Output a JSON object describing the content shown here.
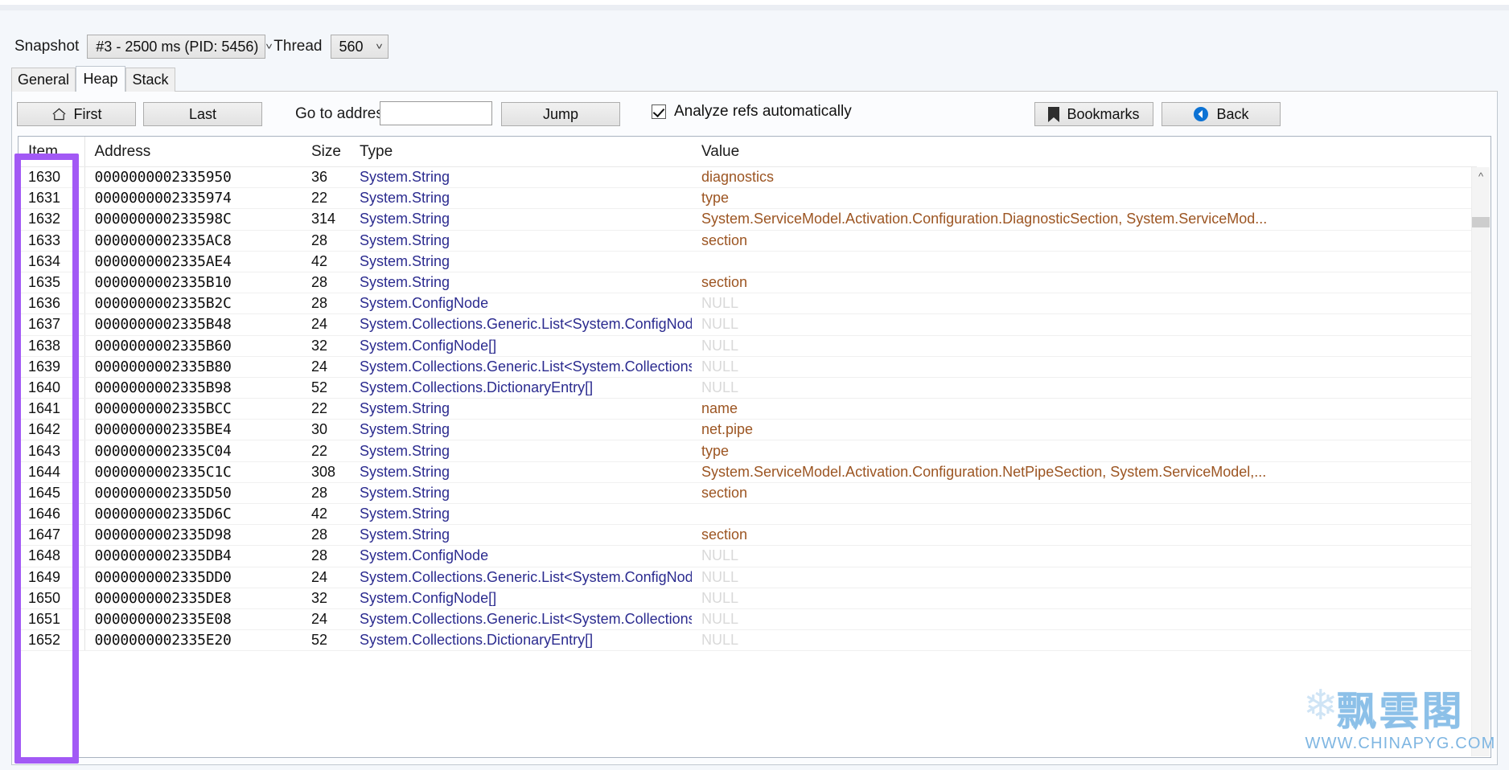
{
  "window": {
    "snapshot_label": "Snapshot",
    "snapshot_value": "#3 - 2500 ms (PID: 5456)",
    "thread_label": "Thread",
    "thread_value": "560"
  },
  "tabs": [
    {
      "label": "General",
      "selected": false
    },
    {
      "label": "Heap",
      "selected": true
    },
    {
      "label": "Stack",
      "selected": false
    }
  ],
  "toolbar": {
    "first_label": "First",
    "first_icon": "home-icon",
    "last_label": "Last",
    "goto_label": "Go to address",
    "address_value": "",
    "address_placeholder": "",
    "jump_label": "Jump",
    "analyze_label": "Analyze refs automatically",
    "analyze_checked": true,
    "bookmarks_label": "Bookmarks",
    "bookmarks_icon": "bookmark-icon",
    "back_label": "Back",
    "back_icon": "back-circle-icon"
  },
  "grid": {
    "columns": [
      "Item",
      "Address",
      "Size",
      "Type",
      "Value"
    ],
    "rows": [
      {
        "item": "1630",
        "address": "0000000002335950",
        "size": "36",
        "type": "System.String",
        "value": "diagnostics",
        "null": false
      },
      {
        "item": "1631",
        "address": "0000000002335974",
        "size": "22",
        "type": "System.String",
        "value": "type",
        "null": false
      },
      {
        "item": "1632",
        "address": "000000000233598C",
        "size": "314",
        "type": "System.String",
        "value": "System.ServiceModel.Activation.Configuration.DiagnosticSection, System.ServiceMod...",
        "null": false
      },
      {
        "item": "1633",
        "address": "0000000002335AC8",
        "size": "28",
        "type": "System.String",
        "value": "section",
        "null": false
      },
      {
        "item": "1634",
        "address": "0000000002335AE4",
        "size": "42",
        "type": "System.String",
        "value": "",
        "null": false
      },
      {
        "item": "1635",
        "address": "0000000002335B10",
        "size": "28",
        "type": "System.String",
        "value": "section",
        "null": false
      },
      {
        "item": "1636",
        "address": "0000000002335B2C",
        "size": "28",
        "type": "System.ConfigNode",
        "value": "NULL",
        "null": true
      },
      {
        "item": "1637",
        "address": "0000000002335B48",
        "size": "24",
        "type": "System.Collections.Generic.List<System.ConfigNode>",
        "value": "NULL",
        "null": true
      },
      {
        "item": "1638",
        "address": "0000000002335B60",
        "size": "32",
        "type": "System.ConfigNode[]",
        "value": "NULL",
        "null": true
      },
      {
        "item": "1639",
        "address": "0000000002335B80",
        "size": "24",
        "type": "System.Collections.Generic.List<System.Collections....",
        "value": "NULL",
        "null": true
      },
      {
        "item": "1640",
        "address": "0000000002335B98",
        "size": "52",
        "type": "System.Collections.DictionaryEntry[]",
        "value": "NULL",
        "null": true
      },
      {
        "item": "1641",
        "address": "0000000002335BCC",
        "size": "22",
        "type": "System.String",
        "value": "name",
        "null": false
      },
      {
        "item": "1642",
        "address": "0000000002335BE4",
        "size": "30",
        "type": "System.String",
        "value": "net.pipe",
        "null": false
      },
      {
        "item": "1643",
        "address": "0000000002335C04",
        "size": "22",
        "type": "System.String",
        "value": "type",
        "null": false
      },
      {
        "item": "1644",
        "address": "0000000002335C1C",
        "size": "308",
        "type": "System.String",
        "value": "System.ServiceModel.Activation.Configuration.NetPipeSection, System.ServiceModel,...",
        "null": false
      },
      {
        "item": "1645",
        "address": "0000000002335D50",
        "size": "28",
        "type": "System.String",
        "value": "section",
        "null": false
      },
      {
        "item": "1646",
        "address": "0000000002335D6C",
        "size": "42",
        "type": "System.String",
        "value": "",
        "null": false
      },
      {
        "item": "1647",
        "address": "0000000002335D98",
        "size": "28",
        "type": "System.String",
        "value": "section",
        "null": false
      },
      {
        "item": "1648",
        "address": "0000000002335DB4",
        "size": "28",
        "type": "System.ConfigNode",
        "value": "NULL",
        "null": true
      },
      {
        "item": "1649",
        "address": "0000000002335DD0",
        "size": "24",
        "type": "System.Collections.Generic.List<System.ConfigNode>",
        "value": "NULL",
        "null": true
      },
      {
        "item": "1650",
        "address": "0000000002335DE8",
        "size": "32",
        "type": "System.ConfigNode[]",
        "value": "NULL",
        "null": true
      },
      {
        "item": "1651",
        "address": "0000000002335E08",
        "size": "24",
        "type": "System.Collections.Generic.List<System.Collections....",
        "value": "NULL",
        "null": true
      },
      {
        "item": "1652",
        "address": "0000000002335E20",
        "size": "52",
        "type": "System.Collections.DictionaryEntry[]",
        "value": "NULL",
        "null": true
      }
    ]
  },
  "scrollbar": {
    "up_arrow": "chevron-up-icon"
  },
  "highlight": {
    "color": "#a259f5"
  },
  "watermark": {
    "cn_text": "飘雲閣",
    "url_text": "WWW.CHINAPYG.COM",
    "color": "#8cc0e8"
  }
}
